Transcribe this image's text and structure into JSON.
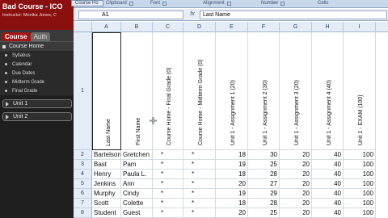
{
  "lms": {
    "course_title": "Bad Course - ICO",
    "instructor": "Instructor: Monika Jones, C",
    "tabs": [
      "Course",
      "Auth"
    ],
    "course_home": "Course Home",
    "menu_items": [
      "Syllabus",
      "Calendar",
      "Due Dates",
      "Midterm Grade",
      "Final Grade"
    ],
    "units": [
      "Unit 1",
      "Unit 2"
    ]
  },
  "excel": {
    "window_tab": "Course Ho",
    "ribbon_groups": [
      "Clipboard",
      "Font",
      "Alignment",
      "Number",
      "Cells"
    ],
    "name_box": "A1",
    "fx": "fx",
    "formula_value": "Last Name",
    "columns": [
      "A",
      "B",
      "C",
      "D",
      "E",
      "F",
      "G",
      "H",
      "I"
    ],
    "header_row_number": "1",
    "headers": [
      "Last Name",
      "First Name",
      "Course Home - Final Grade (0)",
      "Course Home - Midterm Grade (0)",
      "Unit 1 - Assignment 1 (20)",
      "Unit 1 - Assignment 2 (30)",
      "Unit 1 - Assignment 3 (20)",
      "Unit 1 - Assignment 4 (40)",
      "Unit 1 - EXAM (100)"
    ],
    "rows": [
      {
        "num": "2",
        "cells": [
          "Bartelson",
          "Gretchen",
          "*",
          "*",
          "18",
          "30",
          "20",
          "40",
          "100"
        ]
      },
      {
        "num": "3",
        "cells": [
          "Bast",
          "Pam",
          "*",
          "*",
          "19",
          "25",
          "20",
          "40",
          "100"
        ]
      },
      {
        "num": "4",
        "cells": [
          "Henry",
          "Paula L.",
          "*",
          "*",
          "18",
          "28",
          "20",
          "40",
          "100"
        ]
      },
      {
        "num": "5",
        "cells": [
          "Jenkins",
          "Ann",
          "*",
          "*",
          "20",
          "27",
          "20",
          "40",
          "100"
        ]
      },
      {
        "num": "6",
        "cells": [
          "Murphy",
          "Cindy",
          "*",
          "*",
          "19",
          "29",
          "20",
          "40",
          "100"
        ]
      },
      {
        "num": "7",
        "cells": [
          "Scott",
          "Colette",
          "*",
          "*",
          "18",
          "28",
          "20",
          "40",
          "100"
        ]
      },
      {
        "num": "8",
        "cells": [
          "Student",
          "Guest",
          "*",
          "*",
          "20",
          "25",
          "20",
          "40",
          "100"
        ]
      }
    ]
  }
}
